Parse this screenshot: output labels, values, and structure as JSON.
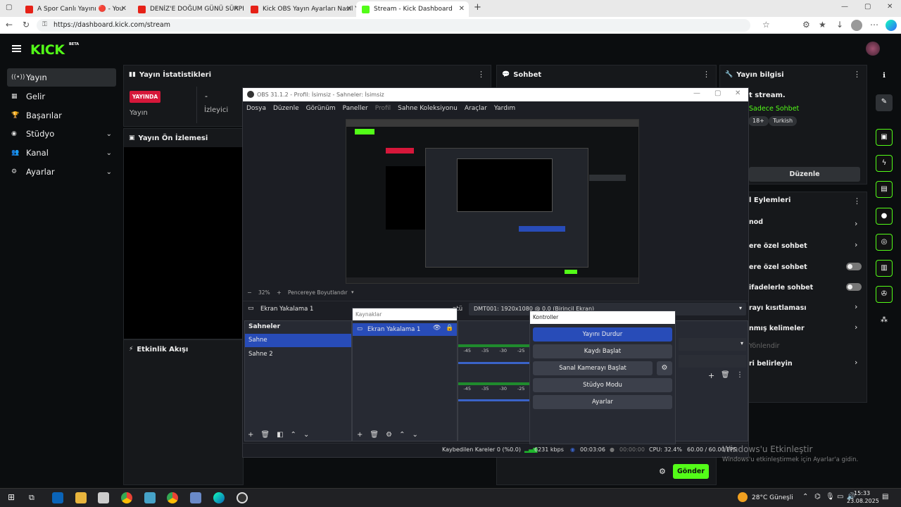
{
  "browser": {
    "tabs": [
      {
        "title": "A Spor Canlı Yayını 🔴 - You",
        "favicon": "youtube-icon"
      },
      {
        "title": "DENİZ'E DOĞUM GÜNÜ SÜRPRİZİ",
        "favicon": "youtube-icon"
      },
      {
        "title": "Kick OBS Yayın Ayarları Nasıl Yapı",
        "favicon": "youtube-icon"
      },
      {
        "title": "Stream - Kick Dashboard",
        "favicon": "kick-icon",
        "active": true
      }
    ],
    "url": "https://dashboard.kick.com/stream"
  },
  "app": {
    "logo": "KICK",
    "beta": "BETA",
    "nav": [
      {
        "label": "Yayın",
        "icon": "broadcast-icon",
        "active": true
      },
      {
        "label": "Gelir",
        "icon": "chart-icon"
      },
      {
        "label": "Başarılar",
        "icon": "trophy-icon"
      },
      {
        "label": "Stüdyo",
        "icon": "palette-icon",
        "expand": true
      },
      {
        "label": "Kanal",
        "icon": "users-icon",
        "expand": true
      },
      {
        "label": "Ayarlar",
        "icon": "gear-icon",
        "expand": true
      }
    ],
    "stats": {
      "title": "Yayın İstatistikleri",
      "live": "YAYINDA",
      "live_label": "Yayın",
      "viewers_value": "-",
      "viewers_label": "İzleyici"
    },
    "preview": {
      "title": "Yayın Ön İzlemesi"
    },
    "activity": {
      "title": "Etkinlik Akışı"
    },
    "chat": {
      "title": "Sohbet",
      "send": "Gönder"
    },
    "info": {
      "title": "Yayın bilgisi",
      "stream_title": "t stream.",
      "mode": "Sadece Sohbet",
      "tags": [
        "18+",
        "Turkish"
      ],
      "edit": "Düzenle",
      "actions_title": "l Eylemleri",
      "actions": [
        {
          "label": "nod",
          "control": "chevron"
        },
        {
          "label": "ere özel sohbet",
          "control": "chevron"
        },
        {
          "label": "ere özel sohbet",
          "control": "toggle"
        },
        {
          "label": "ifadelerle sohbet",
          "control": "toggle"
        },
        {
          "label": "rayı kısıtlaması",
          "control": "chevron"
        },
        {
          "label": "nmış kelimeler",
          "control": "chevron"
        },
        {
          "label": "Yönlendir",
          "control": "none",
          "dim": true
        },
        {
          "label": "ri belirleyin",
          "control": "chevron"
        }
      ]
    }
  },
  "obs": {
    "title": "OBS 31.1.2 - Profil: İsimsiz - Sahneler: İsimsiz",
    "menu": [
      "Dosya",
      "Düzenle",
      "Görünüm",
      "Paneller",
      "Profil",
      "Sahne Koleksiyonu",
      "Araçlar",
      "Yardım"
    ],
    "zoom": "32%",
    "fit": "Pencereye Boyutlandır",
    "source_bar_label": "Ekran Yakalama 1",
    "display_label": "ntü",
    "display_value": "DMT001: 1920x1080 @ 0,0 (Birincil Ekran)",
    "scenes_title": "Sahneler",
    "scenes": [
      "Sahne",
      "Sahne 2"
    ],
    "sources_title": "Kaynaklar",
    "sources": [
      "Ekran Yakalama 1"
    ],
    "meter_ticks": [
      "-45",
      "-35",
      "-30",
      "-25"
    ],
    "controls_title": "Kontroller",
    "controls": [
      "Yayını Durdur",
      "Kaydı Başlat",
      "Sanal Kamerayı Başlat",
      "Stüdyo Modu",
      "Ayarlar"
    ],
    "status": {
      "dropped": "Kaybedilen Kareler 0 (%0.0)",
      "bitrate": "6231 kbps",
      "stream_time": "00:03:06",
      "rec_time": "00:00:00",
      "cpu": "CPU: 32.4%",
      "fps": "60.00 / 60.00 FPS"
    }
  },
  "watermark": {
    "line1": "Windows'u Etkinleştir",
    "line2": "Windows'u etkinleştirmek için Ayarlar'a gidin."
  },
  "taskbar": {
    "weather": "28°C  Güneşli",
    "time": "15:33",
    "date": "23.08.2025"
  },
  "colors": {
    "kick_green": "#53fc18",
    "live_red": "#d6173a",
    "obs_blue": "#284cb8"
  }
}
